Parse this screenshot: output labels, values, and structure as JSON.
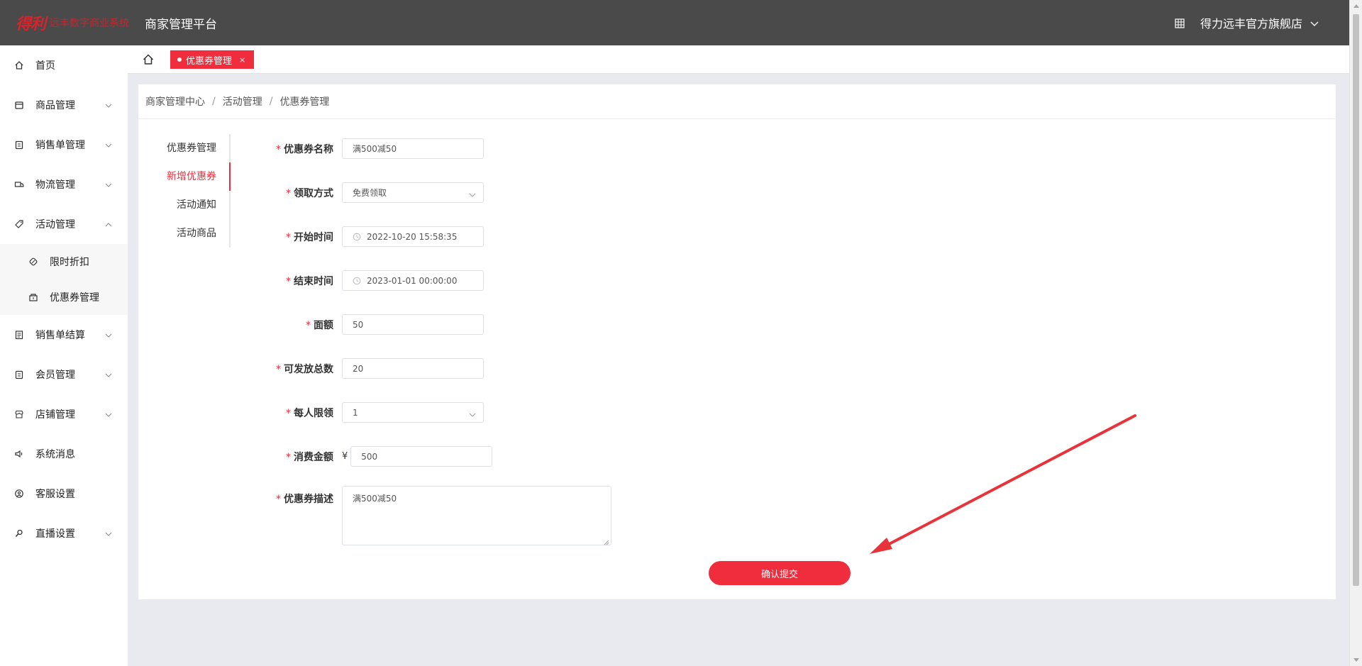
{
  "header": {
    "logo_mark": "得利",
    "system_name": "远丰数字商业系统",
    "platform_title": "商家管理平台",
    "store_name": "得力远丰官方旗舰店"
  },
  "sidebar": {
    "items": [
      {
        "label": "首页",
        "icon": "home-icon"
      },
      {
        "label": "商品管理",
        "icon": "box-icon"
      },
      {
        "label": "销售单管理",
        "icon": "clipboard-icon"
      },
      {
        "label": "物流管理",
        "icon": "truck-icon"
      },
      {
        "label": "活动管理",
        "icon": "tag-icon"
      },
      {
        "label": "限时折扣",
        "icon": "discount-icon"
      },
      {
        "label": "优惠券管理",
        "icon": "coupon-icon"
      },
      {
        "label": "销售单结算",
        "icon": "receipt-icon"
      },
      {
        "label": "会员管理",
        "icon": "member-icon"
      },
      {
        "label": "店铺管理",
        "icon": "store-icon"
      },
      {
        "label": "系统消息",
        "icon": "speaker-icon"
      },
      {
        "label": "客服设置",
        "icon": "support-icon"
      },
      {
        "label": "直播设置",
        "icon": "live-icon"
      }
    ]
  },
  "tabs": {
    "active": "优惠券管理",
    "close": "×"
  },
  "breadcrumb": [
    "商家管理中心",
    "活动管理",
    "优惠券管理"
  ],
  "breadcrumb_sep": "/",
  "subnav": [
    "优惠券管理",
    "新增优惠券",
    "活动通知",
    "活动商品"
  ],
  "form": {
    "required_mark": "*",
    "coupon_name": {
      "label": "优惠券名称",
      "value": "满500减50"
    },
    "claim_method": {
      "label": "领取方式",
      "value": "免费领取"
    },
    "start_time": {
      "label": "开始时间",
      "value": "2022-10-20 15:58:35"
    },
    "end_time": {
      "label": "结束时间",
      "value": "2023-01-01 00:00:00"
    },
    "face_value": {
      "label": "面额",
      "value": "50"
    },
    "total_quantity": {
      "label": "可发放总数",
      "value": "20"
    },
    "limit_per_person": {
      "label": "每人限领",
      "value": "1"
    },
    "min_spend": {
      "label": "消费金额",
      "currency": "¥",
      "value": "500"
    },
    "description": {
      "label": "优惠券描述",
      "value": "满500减50"
    },
    "submit_label": "确认提交"
  },
  "colors": {
    "accent": "#ef2d3c",
    "header_bg": "#4a4a4a",
    "page_bg": "#e9eaef"
  }
}
